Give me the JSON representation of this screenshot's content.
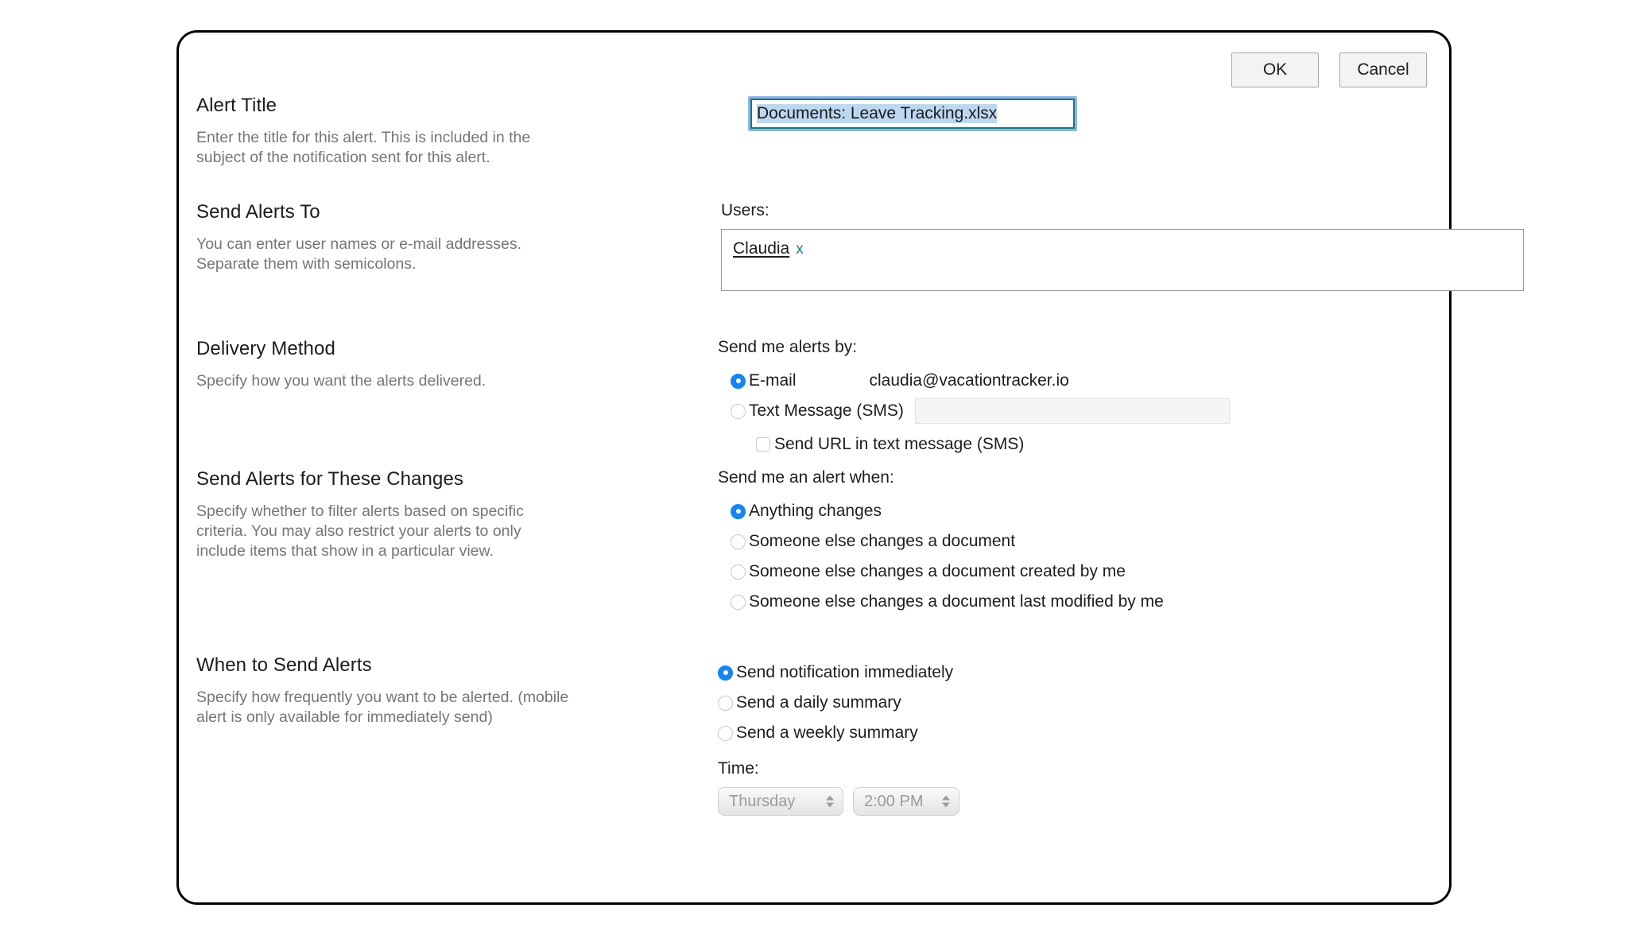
{
  "dialog": {
    "buttons": {
      "ok": "OK",
      "cancel": "Cancel"
    }
  },
  "sections": {
    "alert_title": {
      "title": "Alert Title",
      "description": "Enter the title for this alert. This is included in the subject of the notification sent for this alert.",
      "input_value": "Documents: Leave Tracking.xlsx"
    },
    "send_alerts_to": {
      "title": "Send Alerts To",
      "description": "You can enter user names or e-mail addresses. Separate them with semicolons.",
      "users_label": "Users:",
      "user_chip": {
        "name": "Claudia",
        "remove": "x"
      }
    },
    "delivery_method": {
      "title": "Delivery Method",
      "description": "Specify how you want the alerts delivered.",
      "prompt": "Send me alerts by:",
      "email_option": "E-mail",
      "email_address": "claudia@vacationtracker.io",
      "sms_option": "Text Message (SMS)",
      "sms_value": "",
      "send_url_option": "Send URL in text message (SMS)"
    },
    "changes": {
      "title": "Send Alerts for These Changes",
      "description": "Specify whether to filter alerts based on specific criteria. You may also restrict your alerts to only include items that show in a particular view.",
      "prompt": "Send me an alert when:",
      "options": [
        "Anything changes",
        "Someone else changes a document",
        "Someone else changes a document created by me",
        "Someone else changes a document last modified by me"
      ]
    },
    "when_to_send": {
      "title": "When to Send Alerts",
      "description": "Specify how frequently you want to be alerted. (mobile alert is only available for immediately send)",
      "options": [
        "Send notification immediately",
        "Send a daily summary",
        "Send a weekly summary"
      ],
      "time_label": "Time:",
      "day_value": "Thursday",
      "hour_value": "2:00 PM"
    }
  },
  "colors": {
    "accent_blue": "#1385f5",
    "focus_ring": "#8bb4e8",
    "input_border_teal": "#127a86",
    "link_teal": "#17818f",
    "selection": "#bcd7f0"
  }
}
